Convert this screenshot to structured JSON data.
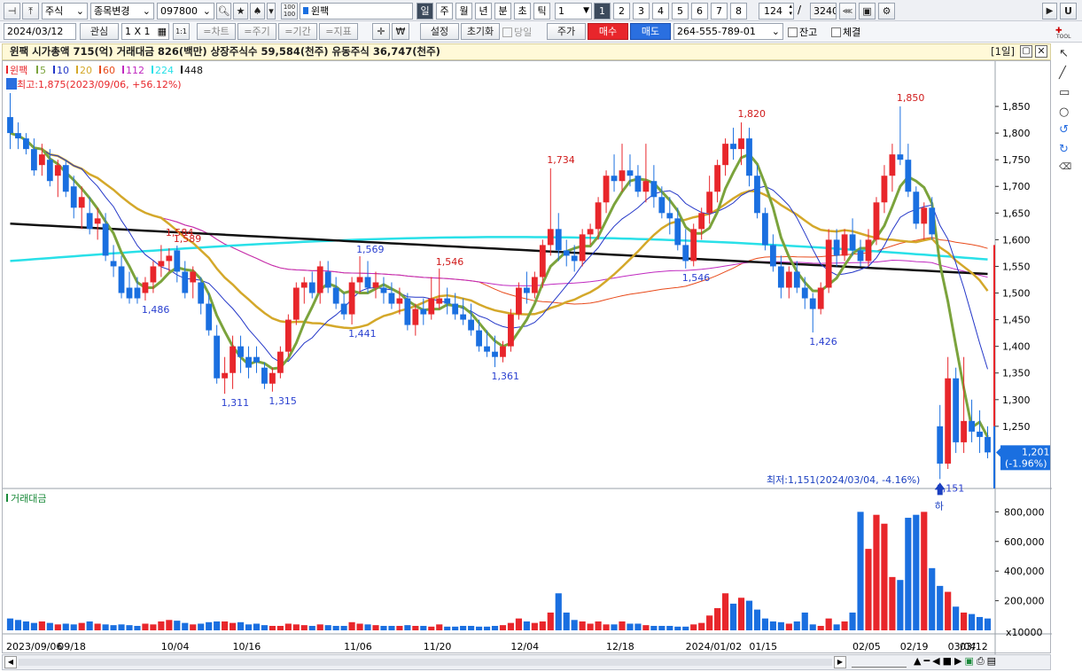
{
  "toolbar1": {
    "market": "주식",
    "change_label": "종목변경",
    "code": "097800",
    "name": "윈팩",
    "periods": [
      "일",
      "주",
      "월",
      "년",
      "분",
      "초",
      "틱"
    ],
    "interval_value": "1",
    "pages": [
      "1",
      "2",
      "3",
      "4",
      "5",
      "6",
      "7",
      "8"
    ],
    "count": "124",
    "total": "3240"
  },
  "toolbar2": {
    "date": "2024/03/12",
    "watch_label": "관심",
    "layout": "1 X 1",
    "tabs": [
      "=차트",
      "=주기",
      "=기간",
      "=지표"
    ],
    "settings": "설정",
    "reset": "초기화",
    "today": "당일",
    "price": "주가",
    "buy": "매수",
    "sell": "매도",
    "account": "264-555-789-01",
    "balance": "잔고",
    "filled": "체결"
  },
  "info": {
    "text": "윈팩  시가총액 715(억)  거래대금 826(백만)  상장주식수 59,584(천주)  유동주식 36,747(천주)",
    "period_tag": "[1일]"
  },
  "right_tools": {
    "tool_label": "TOOL"
  },
  "colors": {
    "up": "#e8262b",
    "down": "#1a6fe0",
    "ma5": "#7ba33c",
    "ma10": "#2437c8",
    "ma20": "#d4a82a",
    "ma60": "#e84a1a",
    "ma112": "#c02ac0",
    "ma224": "#29e0e8",
    "ma448": "#111111"
  },
  "chart_data": {
    "type": "candlestick",
    "legend": [
      {
        "name": "윈팩",
        "color": "#e8262b"
      },
      {
        "name": "5",
        "color": "#7ba33c"
      },
      {
        "name": "10",
        "color": "#2437c8"
      },
      {
        "name": "20",
        "color": "#d4a82a"
      },
      {
        "name": "60",
        "color": "#e84a1a"
      },
      {
        "name": "112",
        "color": "#c02ac0"
      },
      {
        "name": "224",
        "color": "#29e0e8"
      },
      {
        "name": "448",
        "color": "#111111"
      }
    ],
    "high_note": "최고:1,875(2023/09/06, +56.12%)",
    "low_note": "최저:1,151(2024/03/04, -4.16%)",
    "current_price": "1,201",
    "current_change": "(-1.96%)",
    "low_marker": "하",
    "price_ticks": [
      "1,850",
      "1,800",
      "1,750",
      "1,700",
      "1,650",
      "1,600",
      "1,550",
      "1,500",
      "1,450",
      "1,400",
      "1,350",
      "1,300",
      "1,250"
    ],
    "price_tick_values": [
      1850,
      1800,
      1750,
      1700,
      1650,
      1600,
      1550,
      1500,
      1450,
      1400,
      1350,
      1300,
      1250
    ],
    "y_range": [
      1140,
      1885
    ],
    "dates": [
      "2023/09/06",
      "09/18",
      "10/04",
      "10/16",
      "11/06",
      "11/20",
      "12/04",
      "12/18",
      "2024/01/02",
      "01/15",
      "02/05",
      "02/19",
      "03/04",
      "03/12"
    ],
    "candles": [
      [
        1830,
        1875,
        1770,
        1800
      ],
      [
        1800,
        1820,
        1770,
        1790
      ],
      [
        1790,
        1800,
        1760,
        1770
      ],
      [
        1770,
        1790,
        1720,
        1730
      ],
      [
        1740,
        1780,
        1720,
        1760
      ],
      [
        1750,
        1770,
        1700,
        1710
      ],
      [
        1720,
        1750,
        1680,
        1740
      ],
      [
        1740,
        1750,
        1680,
        1690
      ],
      [
        1700,
        1720,
        1640,
        1660
      ],
      [
        1660,
        1700,
        1620,
        1680
      ],
      [
        1650,
        1680,
        1610,
        1620
      ],
      [
        1630,
        1660,
        1600,
        1640
      ],
      [
        1630,
        1650,
        1560,
        1570
      ],
      [
        1560,
        1590,
        1530,
        1550
      ],
      [
        1550,
        1570,
        1490,
        1500
      ],
      [
        1510,
        1540,
        1480,
        1490
      ],
      [
        1510,
        1530,
        1480,
        1490
      ],
      [
        1500,
        1530,
        1486,
        1520
      ],
      [
        1520,
        1560,
        1500,
        1550
      ],
      [
        1550,
        1590,
        1530,
        1560
      ],
      [
        1560,
        1584,
        1540,
        1570
      ],
      [
        1580,
        1589,
        1520,
        1540
      ],
      [
        1540,
        1560,
        1490,
        1500
      ],
      [
        1520,
        1550,
        1490,
        1540
      ],
      [
        1520,
        1530,
        1460,
        1480
      ],
      [
        1480,
        1500,
        1420,
        1430
      ],
      [
        1420,
        1440,
        1330,
        1340
      ],
      [
        1340,
        1380,
        1311,
        1350
      ],
      [
        1350,
        1420,
        1320,
        1400
      ],
      [
        1400,
        1420,
        1350,
        1380
      ],
      [
        1380,
        1400,
        1340,
        1360
      ],
      [
        1380,
        1400,
        1350,
        1370
      ],
      [
        1360,
        1370,
        1320,
        1330
      ],
      [
        1330,
        1360,
        1315,
        1350
      ],
      [
        1350,
        1400,
        1340,
        1390
      ],
      [
        1390,
        1460,
        1380,
        1450
      ],
      [
        1450,
        1520,
        1440,
        1510
      ],
      [
        1510,
        1530,
        1480,
        1520
      ],
      [
        1520,
        1540,
        1490,
        1500
      ],
      [
        1500,
        1560,
        1480,
        1550
      ],
      [
        1540,
        1560,
        1500,
        1510
      ],
      [
        1510,
        1530,
        1470,
        1480
      ],
      [
        1480,
        1500,
        1450,
        1460
      ],
      [
        1460,
        1530,
        1441,
        1520
      ],
      [
        1520,
        1569,
        1500,
        1530
      ],
      [
        1530,
        1560,
        1500,
        1510
      ],
      [
        1510,
        1540,
        1490,
        1520
      ],
      [
        1510,
        1530,
        1480,
        1500
      ],
      [
        1500,
        1520,
        1470,
        1480
      ],
      [
        1480,
        1510,
        1460,
        1490
      ],
      [
        1490,
        1500,
        1430,
        1440
      ],
      [
        1440,
        1480,
        1420,
        1470
      ],
      [
        1470,
        1490,
        1440,
        1460
      ],
      [
        1460,
        1530,
        1450,
        1490
      ],
      [
        1480,
        1546,
        1470,
        1490
      ],
      [
        1490,
        1510,
        1460,
        1480
      ],
      [
        1480,
        1500,
        1450,
        1460
      ],
      [
        1460,
        1490,
        1440,
        1450
      ],
      [
        1450,
        1480,
        1420,
        1430
      ],
      [
        1430,
        1450,
        1390,
        1400
      ],
      [
        1400,
        1430,
        1380,
        1390
      ],
      [
        1390,
        1420,
        1361,
        1380
      ],
      [
        1380,
        1410,
        1370,
        1400
      ],
      [
        1400,
        1470,
        1390,
        1460
      ],
      [
        1460,
        1520,
        1450,
        1510
      ],
      [
        1510,
        1540,
        1480,
        1500
      ],
      [
        1500,
        1540,
        1490,
        1530
      ],
      [
        1530,
        1600,
        1510,
        1590
      ],
      [
        1590,
        1734,
        1570,
        1620
      ],
      [
        1620,
        1650,
        1560,
        1580
      ],
      [
        1580,
        1600,
        1550,
        1570
      ],
      [
        1570,
        1590,
        1540,
        1560
      ],
      [
        1560,
        1620,
        1550,
        1610
      ],
      [
        1610,
        1630,
        1590,
        1620
      ],
      [
        1620,
        1680,
        1600,
        1670
      ],
      [
        1670,
        1730,
        1650,
        1720
      ],
      [
        1720,
        1760,
        1690,
        1710
      ],
      [
        1710,
        1780,
        1690,
        1730
      ],
      [
        1730,
        1760,
        1700,
        1720
      ],
      [
        1720,
        1740,
        1680,
        1690
      ],
      [
        1690,
        1780,
        1670,
        1710
      ],
      [
        1710,
        1740,
        1660,
        1680
      ],
      [
        1680,
        1700,
        1640,
        1650
      ],
      [
        1650,
        1680,
        1610,
        1640
      ],
      [
        1640,
        1660,
        1580,
        1590
      ],
      [
        1590,
        1620,
        1546,
        1560
      ],
      [
        1560,
        1630,
        1550,
        1620
      ],
      [
        1620,
        1660,
        1600,
        1650
      ],
      [
        1650,
        1720,
        1630,
        1690
      ],
      [
        1690,
        1750,
        1670,
        1740
      ],
      [
        1740,
        1790,
        1720,
        1780
      ],
      [
        1780,
        1810,
        1750,
        1770
      ],
      [
        1770,
        1820,
        1740,
        1790
      ],
      [
        1790,
        1810,
        1700,
        1720
      ],
      [
        1720,
        1740,
        1640,
        1650
      ],
      [
        1650,
        1660,
        1580,
        1590
      ],
      [
        1590,
        1610,
        1540,
        1550
      ],
      [
        1550,
        1570,
        1490,
        1510
      ],
      [
        1510,
        1550,
        1490,
        1540
      ],
      [
        1540,
        1560,
        1500,
        1510
      ],
      [
        1510,
        1530,
        1470,
        1490
      ],
      [
        1490,
        1500,
        1426,
        1470
      ],
      [
        1470,
        1520,
        1460,
        1510
      ],
      [
        1510,
        1620,
        1500,
        1600
      ],
      [
        1600,
        1620,
        1550,
        1570
      ],
      [
        1570,
        1620,
        1560,
        1610
      ],
      [
        1610,
        1640,
        1570,
        1580
      ],
      [
        1580,
        1600,
        1550,
        1560
      ],
      [
        1560,
        1620,
        1550,
        1600
      ],
      [
        1600,
        1680,
        1590,
        1670
      ],
      [
        1670,
        1740,
        1650,
        1720
      ],
      [
        1720,
        1780,
        1690,
        1760
      ],
      [
        1760,
        1850,
        1740,
        1750
      ],
      [
        1750,
        1780,
        1680,
        1690
      ],
      [
        1690,
        1700,
        1620,
        1630
      ],
      [
        1630,
        1670,
        1600,
        1660
      ],
      [
        1660,
        1680,
        1600,
        1610
      ],
      [
        1250,
        1290,
        1151,
        1180
      ],
      [
        1180,
        1380,
        1170,
        1340
      ],
      [
        1340,
        1360,
        1200,
        1220
      ],
      [
        1220,
        1380,
        1200,
        1260
      ],
      [
        1260,
        1300,
        1220,
        1240
      ],
      [
        1240,
        1280,
        1200,
        1230
      ],
      [
        1230,
        1250,
        1190,
        1201
      ]
    ],
    "volume_ticks": [
      "800,000",
      "600,000",
      "400,000",
      "200,000"
    ],
    "volume_tick_values": [
      800000,
      600000,
      400000,
      200000
    ],
    "volume_unit": "x10000",
    "volume_title": "거래대금",
    "volumes": [
      80,
      70,
      60,
      50,
      60,
      50,
      40,
      45,
      40,
      50,
      60,
      45,
      40,
      35,
      40,
      35,
      30,
      45,
      40,
      60,
      70,
      65,
      50,
      40,
      45,
      55,
      60,
      60,
      50,
      55,
      40,
      45,
      35,
      30,
      30,
      45,
      40,
      35,
      30,
      40,
      35,
      30,
      30,
      55,
      45,
      40,
      35,
      30,
      30,
      30,
      35,
      30,
      30,
      25,
      40,
      25,
      25,
      30,
      30,
      25,
      25,
      30,
      35,
      50,
      80,
      60,
      50,
      60,
      120,
      250,
      120,
      70,
      60,
      45,
      60,
      40,
      40,
      60,
      45,
      45,
      35,
      30,
      30,
      30,
      25,
      25,
      40,
      50,
      100,
      150,
      250,
      180,
      220,
      200,
      140,
      80,
      60,
      55,
      45,
      60,
      120,
      40,
      30,
      80,
      40,
      60,
      120,
      800,
      550,
      780,
      720,
      360,
      340,
      760,
      780,
      800,
      420,
      300,
      260,
      160,
      120,
      110,
      90,
      80
    ],
    "price_labels": [
      "1,850",
      "1,820",
      "1,734",
      "1,589",
      "1,584",
      "1,569",
      "1,546",
      "1,546",
      "1,486",
      "1,441",
      "1,426",
      "1,361",
      "1,315",
      "1,311",
      "1,151"
    ]
  }
}
